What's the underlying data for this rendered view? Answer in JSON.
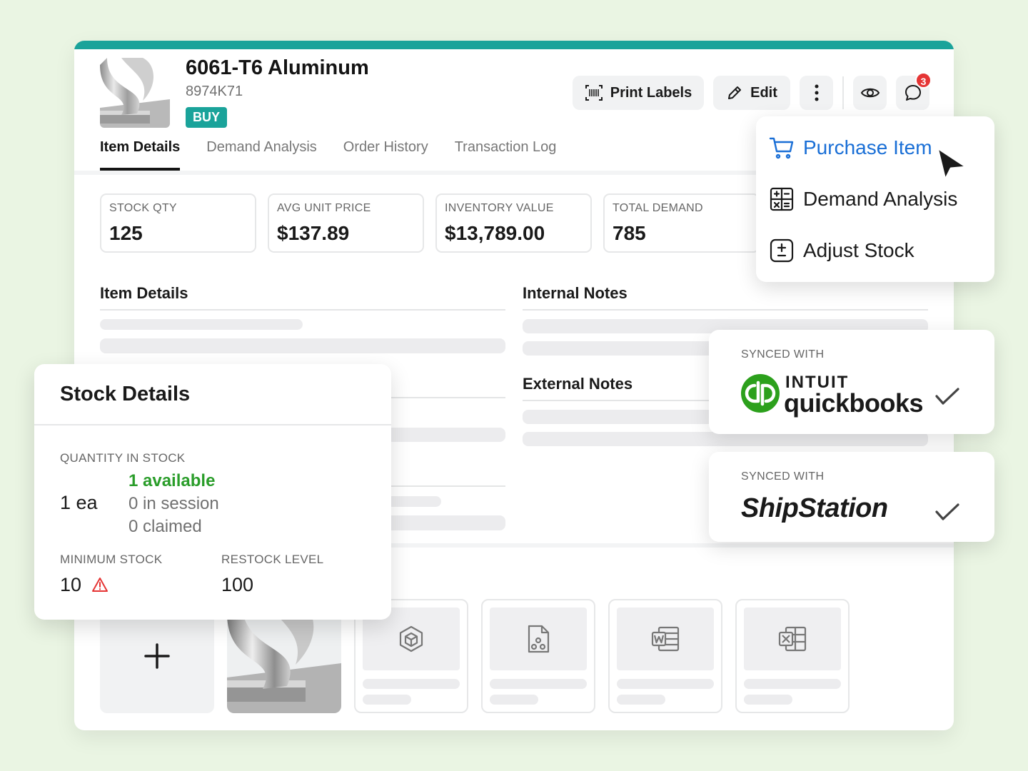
{
  "item": {
    "title": "6061-T6 Aluminum",
    "sku": "8974K71",
    "badge": "BUY"
  },
  "toolbar": {
    "print_labels": "Print Labels",
    "edit": "Edit",
    "notification_count": "3"
  },
  "tabs": [
    {
      "label": "Item Details",
      "active": true
    },
    {
      "label": "Demand Analysis",
      "active": false
    },
    {
      "label": "Order History",
      "active": false
    },
    {
      "label": "Transaction Log",
      "active": false
    }
  ],
  "stats": [
    {
      "label": "STOCK QTY",
      "value": "125"
    },
    {
      "label": "AVG UNIT PRICE",
      "value": "$137.89"
    },
    {
      "label": "INVENTORY VALUE",
      "value": "$13,789.00"
    },
    {
      "label": "TOTAL DEMAND",
      "value": "785"
    }
  ],
  "sections": {
    "item_details": "Item Details",
    "internal_notes": "Internal Notes",
    "external_notes": "External Notes"
  },
  "menu": {
    "items": [
      {
        "label": "Purchase Item",
        "icon": "cart-icon"
      },
      {
        "label": "Demand Analysis",
        "icon": "calculator-icon"
      },
      {
        "label": "Adjust Stock",
        "icon": "plus-minus-icon"
      }
    ]
  },
  "sync": [
    {
      "label": "SYNCED WITH",
      "brand_top": "INTUIT",
      "brand": "quickbooks"
    },
    {
      "label": "SYNCED WITH",
      "brand": "ShipStation"
    }
  ],
  "stock_details": {
    "title": "Stock Details",
    "quantity_label": "QUANTITY IN STOCK",
    "quantity": "1 ea",
    "available": "1 available",
    "in_session": "0 in session",
    "claimed": "0 claimed",
    "minimum_label": "MINIMUM STOCK",
    "minimum": "10",
    "restock_label": "RESTOCK LEVEL",
    "restock": "100"
  },
  "colors": {
    "accent": "#1aa39a",
    "link": "#1a6fd6",
    "available": "#2a9d2a",
    "alert": "#e53535",
    "background": "#eaf5e3"
  }
}
